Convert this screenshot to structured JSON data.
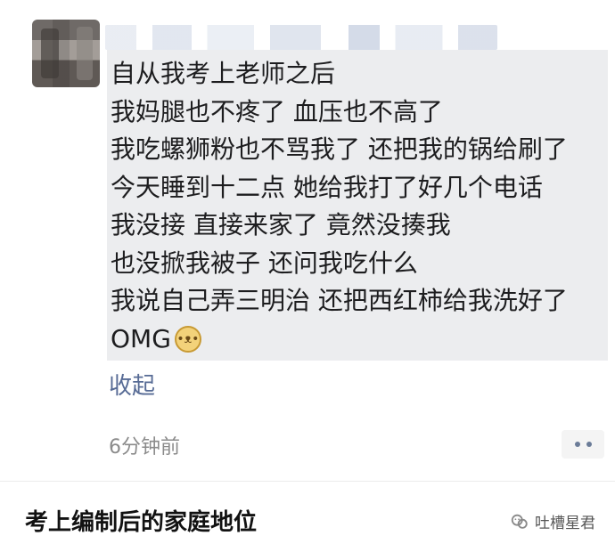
{
  "post": {
    "lines": [
      "自从我考上老师之后",
      "我妈腿也不疼了 血压也不高了",
      "我吃螺狮粉也不骂我了 还把我的锅给刷了",
      "今天睡到十二点 她给我打了好几个电话",
      "我没接 直接来家了 竟然没揍我",
      "也没掀我被子 还问我吃什么",
      "我说自己弄三明治 还把西红柿给我洗好了",
      "OMG"
    ],
    "emoji": "doge-emoji",
    "collapse_label": "收起",
    "time": "6分钟前"
  },
  "caption": "考上编制后的家庭地位",
  "brand": {
    "name": "吐槽星君",
    "icon": "wechat-icon"
  },
  "colors": {
    "link_blue": "#576b95",
    "bubble_bg": "#ecedef"
  }
}
